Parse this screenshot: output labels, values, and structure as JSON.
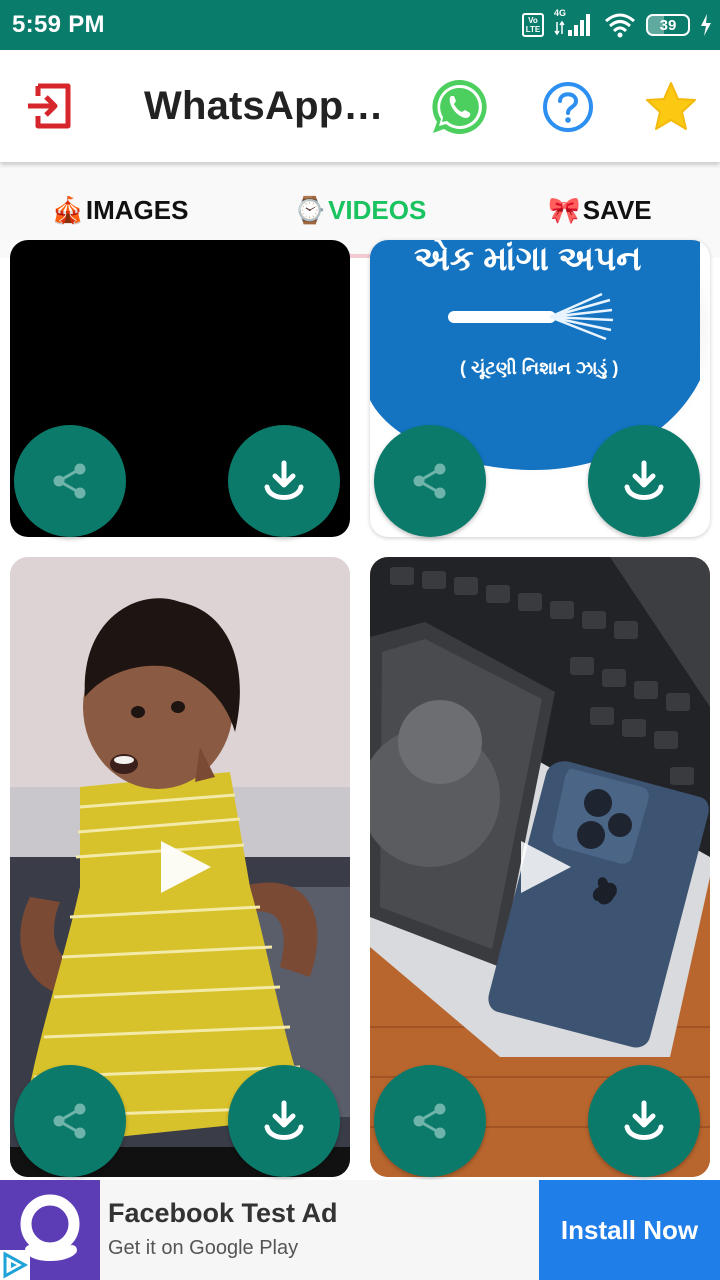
{
  "status_bar": {
    "time": "5:59 PM",
    "volte_top": "Vo",
    "volte_bottom": "LTE",
    "network": "4G",
    "battery": "39"
  },
  "app_bar": {
    "title": "WhatsApp…",
    "icons": [
      "exit-icon",
      "whatsapp-icon",
      "help-icon",
      "star-icon"
    ],
    "accent_color": "#0a7c6b"
  },
  "tabs": [
    {
      "emoji": "🎪",
      "label": "IMAGES"
    },
    {
      "emoji": "⌚",
      "label": "VIDEOS",
      "active": true
    },
    {
      "emoji": "🎀",
      "label": "SAVE"
    }
  ],
  "thumb2_text": {
    "line1": "એક માંગા અપન",
    "line2": "( ચૂંટણી નિશાન ઝાડું )"
  },
  "ad": {
    "title": "Facebook Test Ad",
    "subtitle": "Get it on Google Play",
    "button": "Install Now",
    "button_color": "#1f7ee8"
  }
}
